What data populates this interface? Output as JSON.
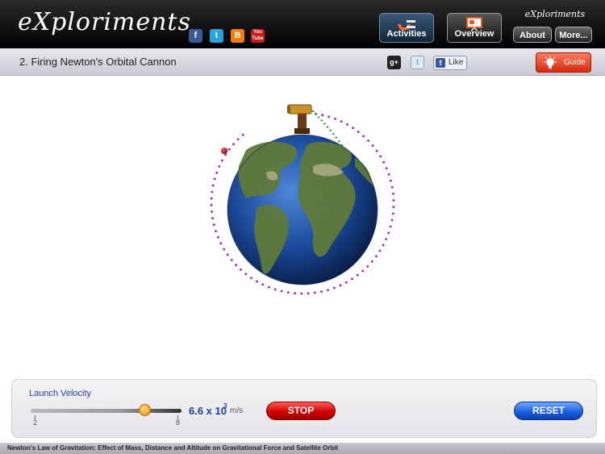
{
  "header": {
    "logo_text": "eXploriments",
    "social": [
      {
        "name": "facebook",
        "glyph": "f",
        "color": "#3b5998"
      },
      {
        "name": "twitter",
        "glyph": "t",
        "color": "#29a3e0"
      },
      {
        "name": "blogger",
        "glyph": "B",
        "color": "#f57d00"
      },
      {
        "name": "youtube",
        "glyph": "You Tube",
        "color": "#cc1b1b"
      }
    ],
    "activities_label": "Activities",
    "overview_label": "Overview",
    "brand_small": "eXploriments",
    "about_label": "About",
    "more_label": "More..."
  },
  "titlebar": {
    "experiment_title": "2. Firing Newton's Orbital Cannon",
    "gplus_label": "g+",
    "twitter_glyph": "t",
    "fb_glyph": "f",
    "like_label": "Like",
    "guide_label": "Guide"
  },
  "controls": {
    "launch_velocity_label": "Launch Velocity",
    "slider": {
      "min": 2,
      "max": 8,
      "value": 6.6
    },
    "min_label": "2",
    "max_label": "8",
    "velocity_mantissa": "6.6 x 10",
    "velocity_exponent": "3",
    "velocity_unit": "m/s",
    "stop_label": "STOP",
    "reset_label": "RESET"
  },
  "footer": {
    "text": "Newton's Law of Gravitation: Effect of Mass, Distance and Altitude on Gravitational Force and Satellite Orbit"
  },
  "colors": {
    "orbit": "#a020b8",
    "trajectory": "#1a9a3a",
    "projectile": "#b21010",
    "accent_blue": "#1f3f9a"
  }
}
